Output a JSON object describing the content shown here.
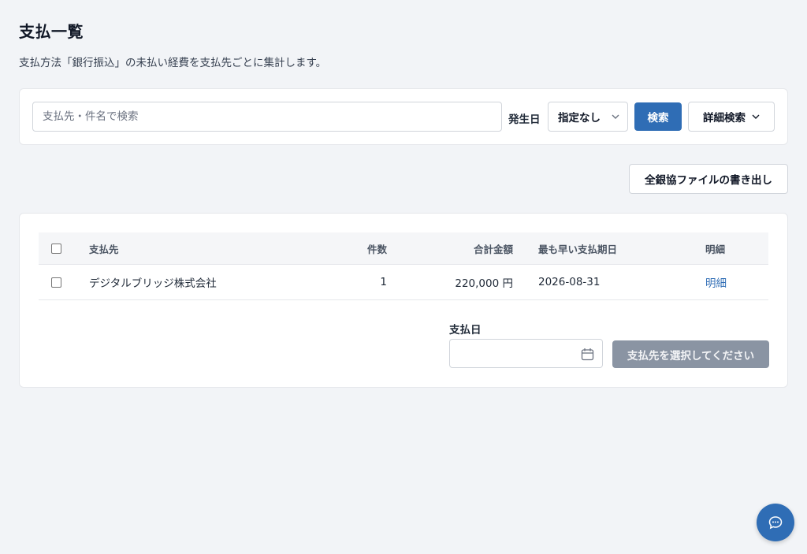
{
  "page": {
    "title": "支払一覧",
    "description": "支払方法「銀行振込」の未払い経費を支払先ごとに集計します。"
  },
  "search": {
    "placeholder": "支払先・件名で検索",
    "value": "",
    "date_label": "発生日",
    "date_select_value": "指定なし",
    "search_button_label": "検索",
    "advanced_button_label": "詳細検索"
  },
  "toolbar": {
    "export_label": "全銀協ファイルの書き出し"
  },
  "table": {
    "columns": [
      "支払先",
      "件数",
      "合計金額",
      "最も早い支払期日",
      "明細"
    ],
    "rows": [
      {
        "payee": "デジタルブリッジ株式会社",
        "count": "1",
        "total": "220,000 円",
        "earliest_due": "2026-08-31",
        "detail_label": "明細"
      }
    ]
  },
  "payment": {
    "date_label": "支払日",
    "date_value": "",
    "confirm_button_label": "支払先を選択してください"
  },
  "colors": {
    "accent": "#2f6db5",
    "disabled_button": "#8a94a3",
    "background": "#f2f4f7"
  },
  "icons": {
    "date_select": "chevron-down-icon",
    "advanced": "chevron-down-icon",
    "payday": "calendar-icon",
    "chat": "chat-bubble-icon"
  }
}
